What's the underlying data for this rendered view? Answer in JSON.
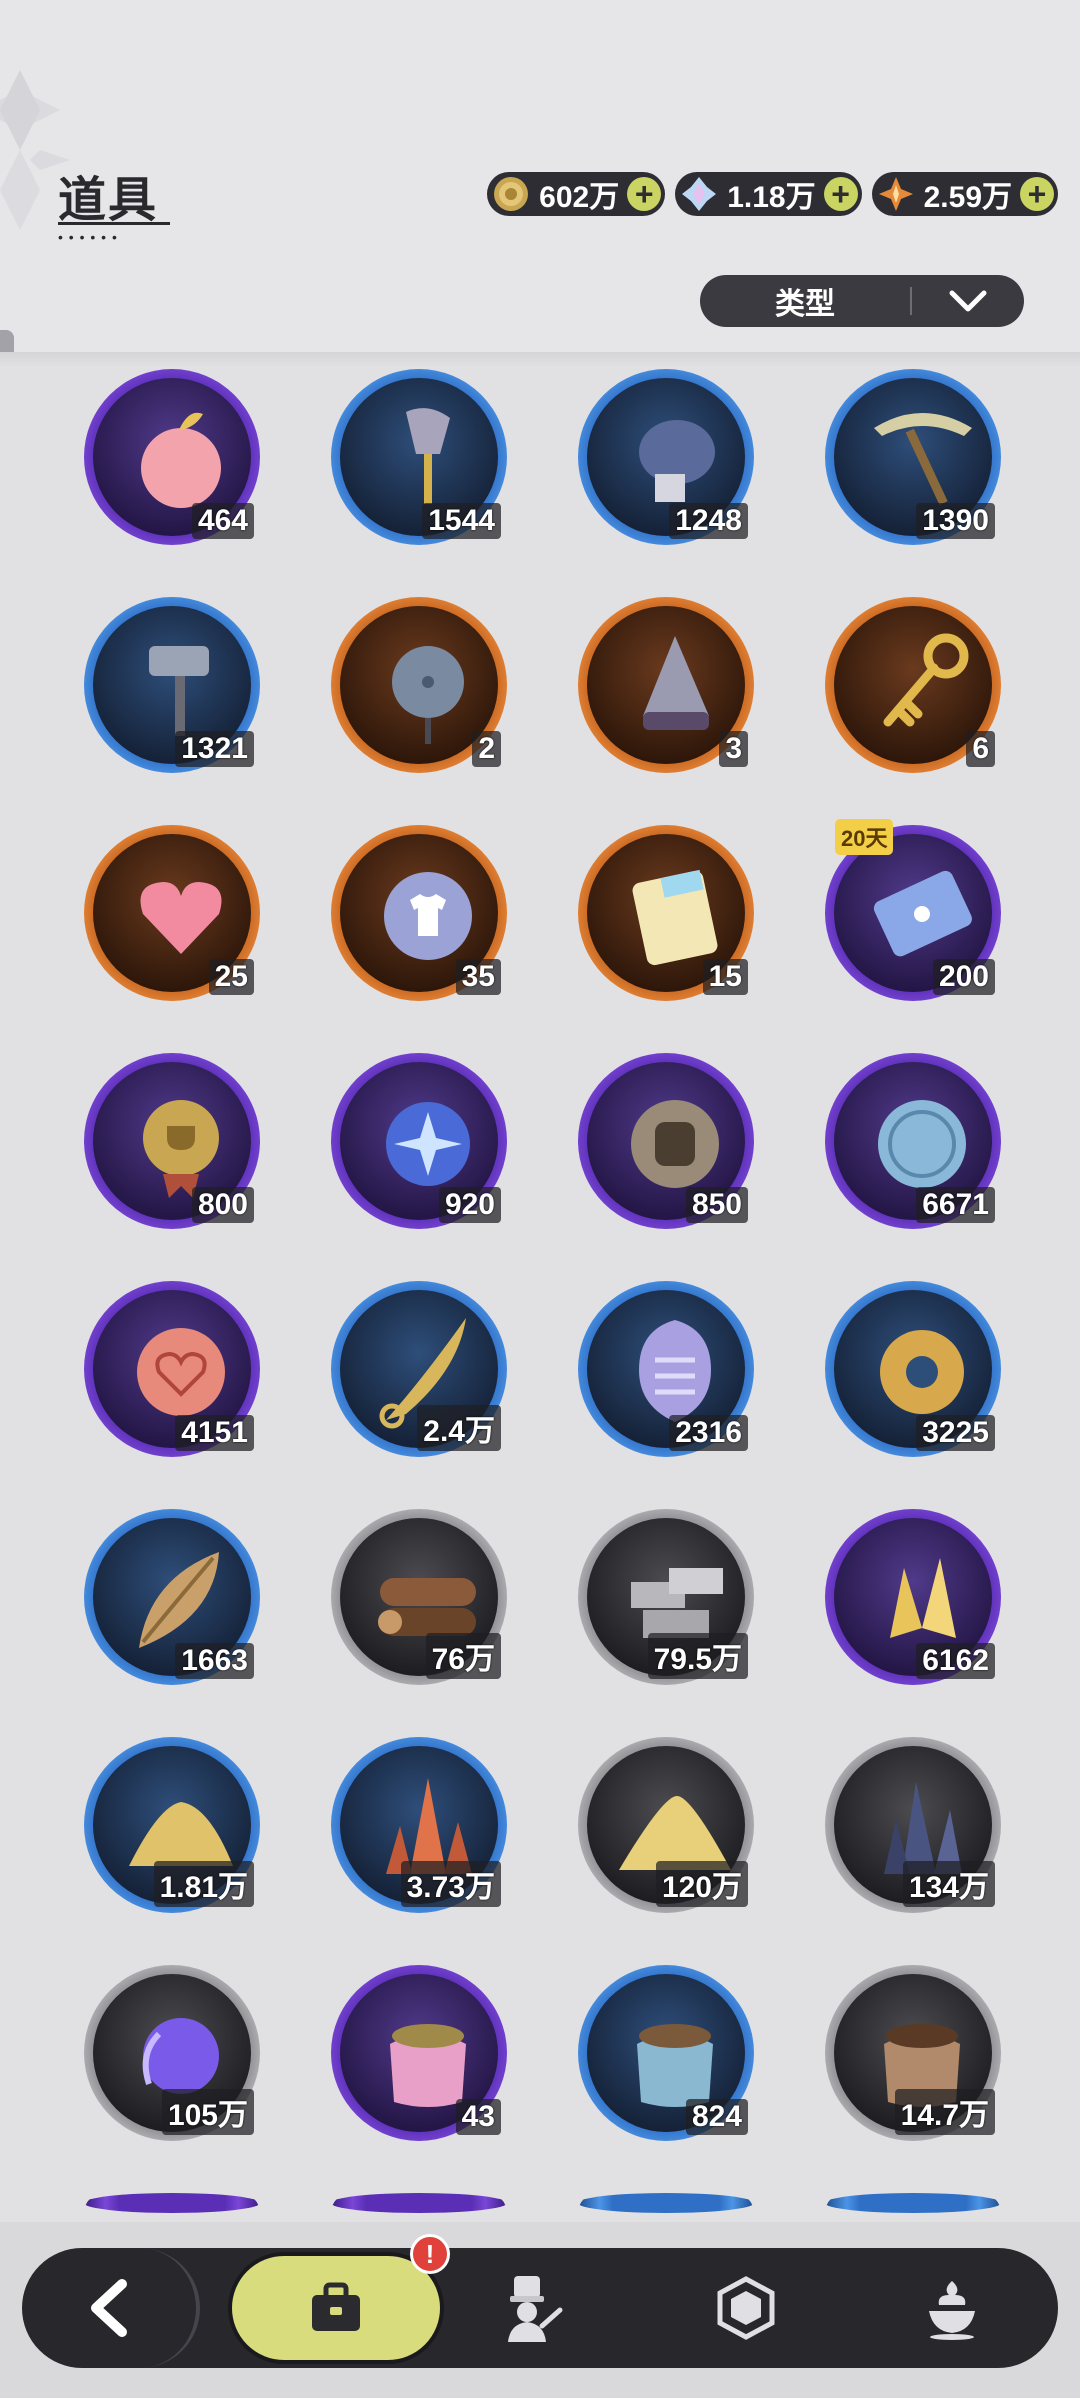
{
  "header": {
    "title": "道具"
  },
  "currencies": [
    {
      "name": "coin",
      "icon": "gold-coin-icon",
      "value": "602万"
    },
    {
      "name": "crystal",
      "icon": "crystal-icon",
      "value": "1.18万"
    },
    {
      "name": "star",
      "icon": "star-gem-icon",
      "value": "2.59万"
    }
  ],
  "filter": {
    "label": "类型"
  },
  "items": [
    {
      "icon": "apple-icon",
      "rarity": "purple",
      "count": "464"
    },
    {
      "icon": "shovel-icon",
      "rarity": "blue",
      "count": "1544"
    },
    {
      "icon": "glove-icon",
      "rarity": "blue",
      "count": "1248"
    },
    {
      "icon": "pickaxe-icon",
      "rarity": "blue",
      "count": "1390"
    },
    {
      "icon": "hammer-icon",
      "rarity": "blue",
      "count": "1321"
    },
    {
      "icon": "spiked-ball-icon",
      "rarity": "orange",
      "count": "2"
    },
    {
      "icon": "drill-icon",
      "rarity": "orange",
      "count": "3"
    },
    {
      "icon": "golden-key-icon",
      "rarity": "orange",
      "count": "6"
    },
    {
      "icon": "pink-gem-heart-icon",
      "rarity": "orange",
      "count": "25"
    },
    {
      "icon": "shirt-token-icon",
      "rarity": "orange",
      "count": "35"
    },
    {
      "icon": "rainbow-ticket-icon",
      "rarity": "orange",
      "count": "15"
    },
    {
      "icon": "blue-ticket-icon",
      "rarity": "purple",
      "count": "200",
      "badge": "20天"
    },
    {
      "icon": "trophy-medal-icon",
      "rarity": "purple",
      "count": "800"
    },
    {
      "icon": "star-orb-icon",
      "rarity": "purple",
      "count": "920"
    },
    {
      "icon": "fist-coin-icon",
      "rarity": "purple",
      "count": "850"
    },
    {
      "icon": "blue-coin-icon",
      "rarity": "purple",
      "count": "6671"
    },
    {
      "icon": "heart-coin-icon",
      "rarity": "purple",
      "count": "4151"
    },
    {
      "icon": "gold-blade-icon",
      "rarity": "blue",
      "count": "2.4万"
    },
    {
      "icon": "scale-shield-icon",
      "rarity": "blue",
      "count": "2316"
    },
    {
      "icon": "gear-coin-icon",
      "rarity": "blue",
      "count": "3225"
    },
    {
      "icon": "leaf-icon",
      "rarity": "blue",
      "count": "1663"
    },
    {
      "icon": "wood-logs-icon",
      "rarity": "gray",
      "count": "76万"
    },
    {
      "icon": "stone-bricks-icon",
      "rarity": "gray",
      "count": "79.5万"
    },
    {
      "icon": "gold-crystal-icon",
      "rarity": "purple",
      "count": "6162"
    },
    {
      "icon": "gold-sand-icon",
      "rarity": "blue",
      "count": "1.81万"
    },
    {
      "icon": "red-crystal-icon",
      "rarity": "blue",
      "count": "3.73万"
    },
    {
      "icon": "sand-pile-icon",
      "rarity": "gray",
      "count": "120万"
    },
    {
      "icon": "dark-crystal-icon",
      "rarity": "gray",
      "count": "134万"
    },
    {
      "icon": "purple-orb-icon",
      "rarity": "gray",
      "count": "105万"
    },
    {
      "icon": "pink-food-bag-icon",
      "rarity": "purple",
      "count": "43"
    },
    {
      "icon": "blue-food-bag-icon",
      "rarity": "blue",
      "count": "824"
    },
    {
      "icon": "brown-food-bag-icon",
      "rarity": "gray",
      "count": "14.7万"
    }
  ],
  "partial_row": [
    {
      "rarity": "purple"
    },
    {
      "rarity": "purple"
    },
    {
      "rarity": "blue"
    },
    {
      "rarity": "blue"
    }
  ],
  "nav": {
    "alert": "!",
    "tabs": [
      {
        "name": "back",
        "icon": "back-arrow-icon"
      },
      {
        "name": "bag",
        "icon": "bag-icon",
        "active": true
      },
      {
        "name": "chef",
        "icon": "chef-icon"
      },
      {
        "name": "gem",
        "icon": "hexagon-gem-icon"
      },
      {
        "name": "dessert",
        "icon": "dessert-icon"
      }
    ]
  },
  "colors": {
    "purple": "#7a46d8",
    "blue": "#4c94e6",
    "orange": "#e8883a",
    "gray": "#b8b8bc",
    "accent": "#d8dc7c",
    "nav_bg": "#27272c"
  }
}
